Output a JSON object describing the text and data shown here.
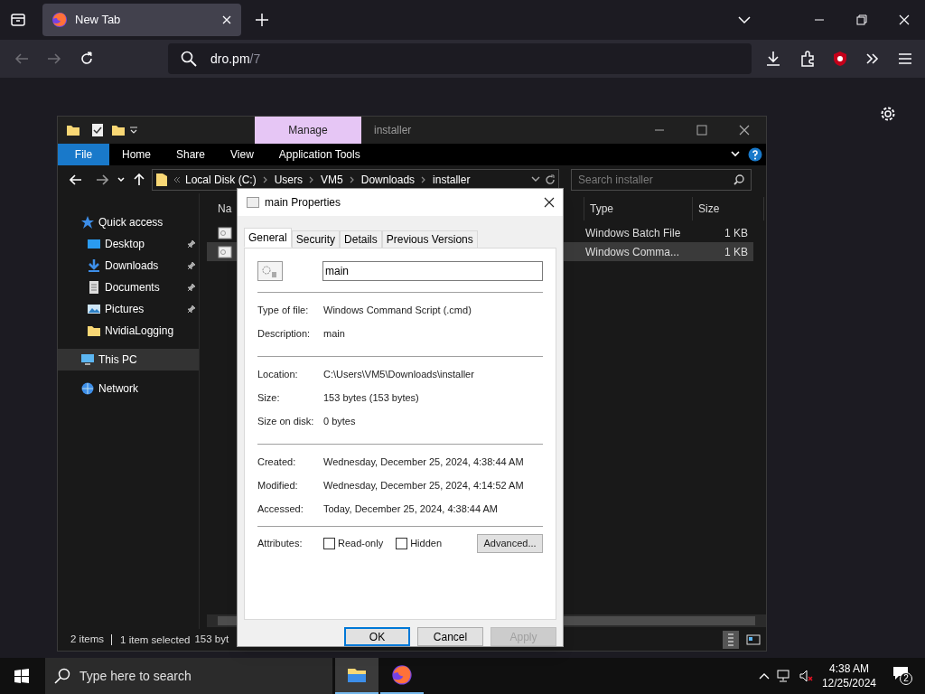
{
  "browser": {
    "tabs": [
      {
        "title": "New Tab",
        "selected": true
      }
    ],
    "url_host": "dro.pm",
    "url_path": "/7"
  },
  "explorer": {
    "title": "installer",
    "context_tab": "Manage",
    "file_tab": "File",
    "ribbon_tabs": [
      "Home",
      "Share",
      "View",
      "Application Tools"
    ],
    "breadcrumb": [
      "Local Disk (C:)",
      "Users",
      "VM5",
      "Downloads",
      "installer"
    ],
    "search": {
      "placeholder": "Search installer"
    },
    "nav": [
      {
        "label": "Quick access",
        "kind": "star",
        "pinned": false,
        "selected": false
      },
      {
        "label": "Desktop",
        "kind": "desktop",
        "pinned": true,
        "selected": false
      },
      {
        "label": "Downloads",
        "kind": "download",
        "pinned": true,
        "selected": false
      },
      {
        "label": "Documents",
        "kind": "document",
        "pinned": true,
        "selected": false
      },
      {
        "label": "Pictures",
        "kind": "picture",
        "pinned": true,
        "selected": false
      },
      {
        "label": "NvidiaLogging",
        "kind": "folder",
        "pinned": false,
        "selected": false
      },
      {
        "label": "This PC",
        "kind": "pc",
        "pinned": false,
        "selected": true
      },
      {
        "label": "Network",
        "kind": "network",
        "pinned": false,
        "selected": false
      }
    ],
    "columns": [
      "Na",
      "Type",
      "Size"
    ],
    "rows": [
      {
        "type": "Windows Batch File",
        "size": "1 KB",
        "selected": false
      },
      {
        "type": "Windows Comma...",
        "size": "1 KB",
        "selected": true
      }
    ],
    "status": [
      "2 items",
      "1 item selected",
      "153 byt"
    ]
  },
  "dialog": {
    "title": "main Properties",
    "tabs": [
      {
        "label": "General",
        "selected": true
      },
      {
        "label": "Security",
        "selected": false
      },
      {
        "label": "Details",
        "selected": false
      },
      {
        "label": "Previous Versions",
        "selected": false
      }
    ],
    "name": "main",
    "groups": [
      [
        {
          "label": "Type of file:",
          "value": "Windows Command Script (.cmd)"
        },
        {
          "label": "Description:",
          "value": "main"
        }
      ],
      [
        {
          "label": "Location:",
          "value": "C:\\Users\\VM5\\Downloads\\installer"
        },
        {
          "label": "Size:",
          "value": "153 bytes (153 bytes)"
        },
        {
          "label": "Size on disk:",
          "value": "0 bytes"
        }
      ],
      [
        {
          "label": "Created:",
          "value": "Wednesday, December 25, 2024, 4:38:44 AM"
        },
        {
          "label": "Modified:",
          "value": "Wednesday, December 25, 2024, 4:14:52 AM"
        },
        {
          "label": "Accessed:",
          "value": "Today, December 25, 2024, 4:38:44 AM"
        }
      ]
    ],
    "attributes_label": "Attributes:",
    "attributes": [
      {
        "label": "Read-only",
        "checked": false
      },
      {
        "label": "Hidden",
        "checked": false
      }
    ],
    "advanced": "Advanced...",
    "buttons": [
      {
        "label": "OK",
        "disabled": false,
        "default": true
      },
      {
        "label": "Cancel",
        "disabled": false,
        "default": false
      },
      {
        "label": "Apply",
        "disabled": true,
        "default": false
      }
    ]
  },
  "taskbar": {
    "search": {
      "placeholder": "Type here to search"
    },
    "apps": [
      {
        "kind": "explorer",
        "active": true
      },
      {
        "kind": "firefox",
        "active": false
      }
    ],
    "time": "4:38 AM",
    "date": "12/25/2024",
    "notifications": "2"
  }
}
